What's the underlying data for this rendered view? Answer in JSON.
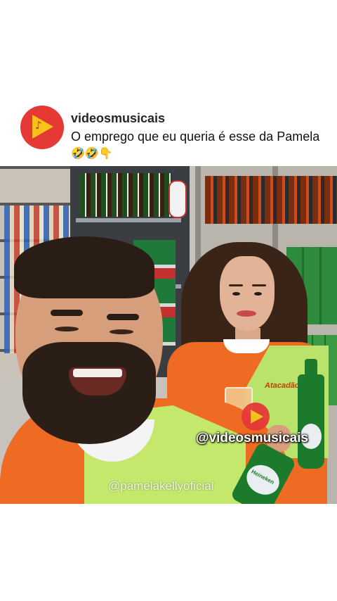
{
  "post": {
    "username": "videosmusicais",
    "caption_text": "O emprego que eu queria é esse da Pamela ",
    "caption_emojis": "🤣🤣👇",
    "avatar_icon": "play-note-logo-icon"
  },
  "video": {
    "watermark_main": "@videosmusicais",
    "watermark_secondary": "@pamelakellyoficial",
    "shirt_brand": "Atacadão",
    "bottle_brand": "Heineken"
  },
  "colors": {
    "brand_red": "#e53935",
    "brand_yellow": "#f7c21a",
    "uniform_orange": "#ef6b24",
    "uniform_green": "#c3e86b"
  }
}
